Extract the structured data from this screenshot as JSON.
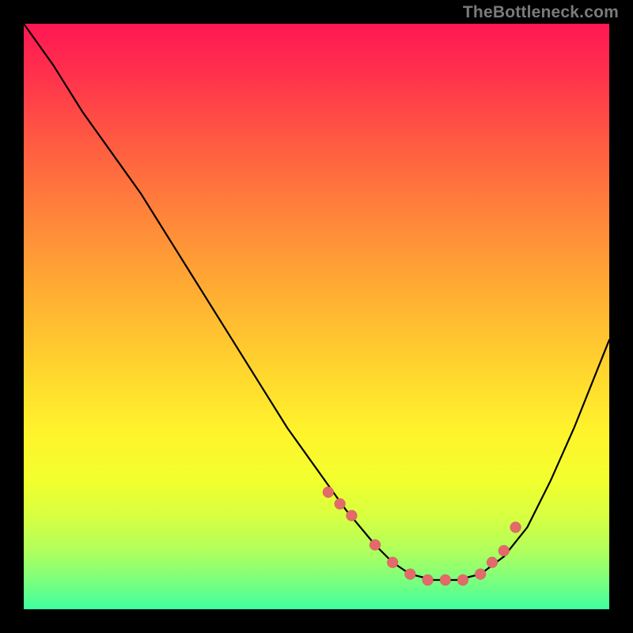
{
  "watermark": "TheBottleneck.com",
  "chart_data": {
    "type": "line",
    "title": "",
    "xlabel": "",
    "ylabel": "",
    "xlim": [
      0,
      100
    ],
    "ylim": [
      0,
      100
    ],
    "grid": false,
    "series": [
      {
        "name": "curve",
        "x": [
          0,
          5,
          10,
          15,
          20,
          25,
          30,
          35,
          40,
          45,
          50,
          55,
          60,
          63,
          66,
          70,
          74,
          78,
          82,
          86,
          90,
          94,
          100
        ],
        "y": [
          100,
          93,
          85,
          78,
          71,
          63,
          55,
          47,
          39,
          31,
          24,
          17,
          11,
          8,
          6,
          5,
          5,
          6,
          9,
          14,
          22,
          31,
          46
        ]
      }
    ],
    "markers": {
      "name": "highlight-dots",
      "x": [
        52,
        54,
        56,
        60,
        63,
        66,
        69,
        72,
        75,
        78,
        80,
        82,
        84
      ],
      "y": [
        20,
        18,
        16,
        11,
        8,
        6,
        5,
        5,
        5,
        6,
        8,
        10,
        14
      ]
    },
    "colors": {
      "curve": "#000000",
      "markers": "#e4696b",
      "gradient_top": "#ff1753",
      "gradient_bottom": "#3effa0"
    }
  }
}
